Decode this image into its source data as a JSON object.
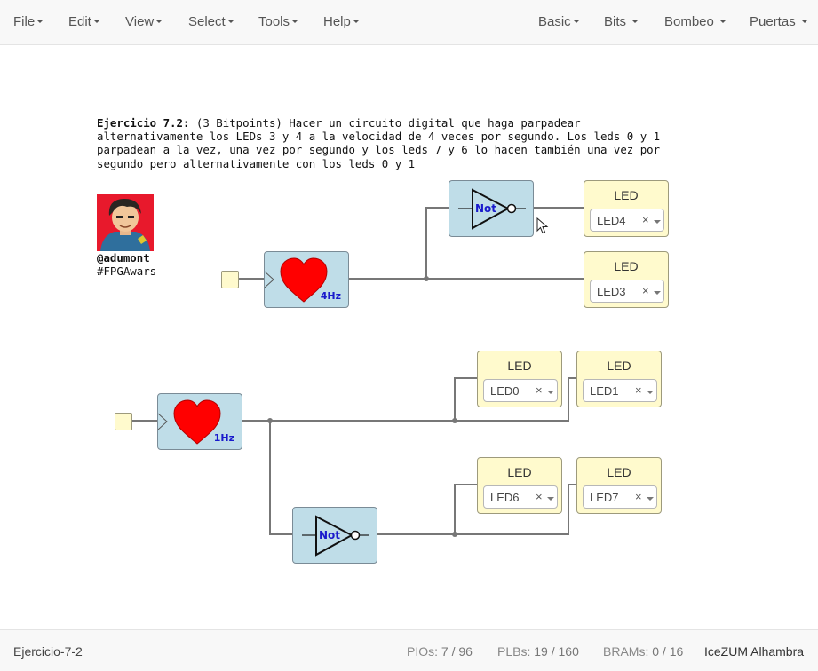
{
  "menubar": {
    "left": [
      "File",
      "Edit",
      "View",
      "Select",
      "Tools",
      "Help"
    ],
    "right": [
      "Basic",
      "Bits",
      "Bombeo",
      "Puertas"
    ]
  },
  "info": {
    "title": "Ejercicio 7.2:",
    "text": " (3 Bitpoints) Hacer un circuito digital que haga parpadear alternativamente los LEDs 3 y 4 a la velocidad de 4 veces por segundo. Los leds 0 y 1 parpadean a la vez, una vez por segundo y los leds 7 y 6 lo hacen también una vez por segundo pero alternativamente con los leds 0 y 1"
  },
  "credits": {
    "handle": "@adumont",
    "tag": "#FPGAwars"
  },
  "circuit": {
    "blinkers": [
      {
        "freq": "4Hz",
        "icon": "heart-icon"
      },
      {
        "freq": "1Hz",
        "icon": "heart-icon"
      }
    ],
    "not_gates": [
      {
        "label": "Not",
        "icon": "not-gate-icon"
      },
      {
        "label": "Not",
        "icon": "not-gate-icon"
      }
    ],
    "leds": [
      {
        "title": "LED",
        "value": "LED4"
      },
      {
        "title": "LED",
        "value": "LED3"
      },
      {
        "title": "LED",
        "value": "LED0"
      },
      {
        "title": "LED",
        "value": "LED1"
      },
      {
        "title": "LED",
        "value": "LED6"
      },
      {
        "title": "LED",
        "value": "LED7"
      }
    ],
    "clear_symbol": "×",
    "colors": {
      "block": "#bfdde8",
      "led": "#fffacd",
      "wire": "#777777",
      "heart": "#ff0000",
      "accent": "#1a1acc"
    }
  },
  "footer": {
    "project": "Ejercicio-7-2",
    "pios_label": "PIOs:",
    "pios_value": "7 / 96",
    "plbs_label": "PLBs:",
    "plbs_value": "19 / 160",
    "brams_label": "BRAMs:",
    "brams_value": "0 / 16",
    "board": "IceZUM Alhambra"
  }
}
